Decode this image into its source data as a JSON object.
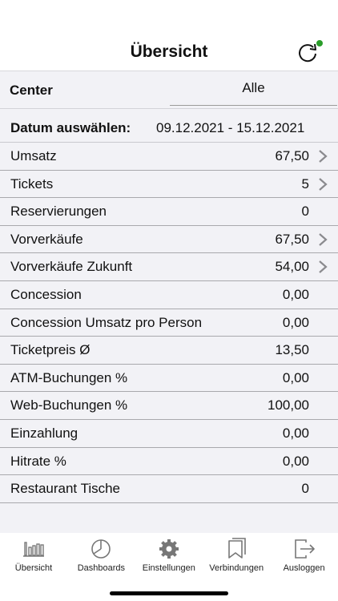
{
  "header": {
    "title": "Übersicht",
    "refresh_icon": "refresh-icon",
    "status_color": "#2a9d2a"
  },
  "center": {
    "label": "Center",
    "value": "Alle"
  },
  "date": {
    "label": "Datum auswählen:",
    "value": "09.12.2021 - 15.12.2021"
  },
  "rows": [
    {
      "label": "Umsatz",
      "value": "67,50",
      "arrow": true
    },
    {
      "label": "Tickets",
      "value": "5",
      "arrow": true
    },
    {
      "label": "Reservierungen",
      "value": "0",
      "arrow": false
    },
    {
      "label": "Vorverkäufe",
      "value": "67,50",
      "arrow": true
    },
    {
      "label": "Vorverkäufe Zukunft",
      "value": "54,00",
      "arrow": true
    },
    {
      "label": "Concession",
      "value": "0,00",
      "arrow": false
    },
    {
      "label": "Concession Umsatz pro Person",
      "value": "0,00",
      "arrow": false
    },
    {
      "label": "Ticketpreis Ø",
      "value": "13,50",
      "arrow": false
    },
    {
      "label": "ATM-Buchungen %",
      "value": "0,00",
      "arrow": false
    },
    {
      "label": "Web-Buchungen %",
      "value": "100,00",
      "arrow": false
    },
    {
      "label": "Einzahlung",
      "value": "0,00",
      "arrow": false
    },
    {
      "label": "Hitrate %",
      "value": "0,00",
      "arrow": false
    },
    {
      "label": "Restaurant Tische",
      "value": "0",
      "arrow": false
    }
  ],
  "tabs": [
    {
      "label": "Übersicht",
      "icon": "bar-chart-icon"
    },
    {
      "label": "Dashboards",
      "icon": "pie-chart-icon"
    },
    {
      "label": "Einstellungen",
      "icon": "gear-icon"
    },
    {
      "label": "Verbindungen",
      "icon": "bookmarks-icon"
    },
    {
      "label": "Ausloggen",
      "icon": "logout-icon"
    }
  ]
}
